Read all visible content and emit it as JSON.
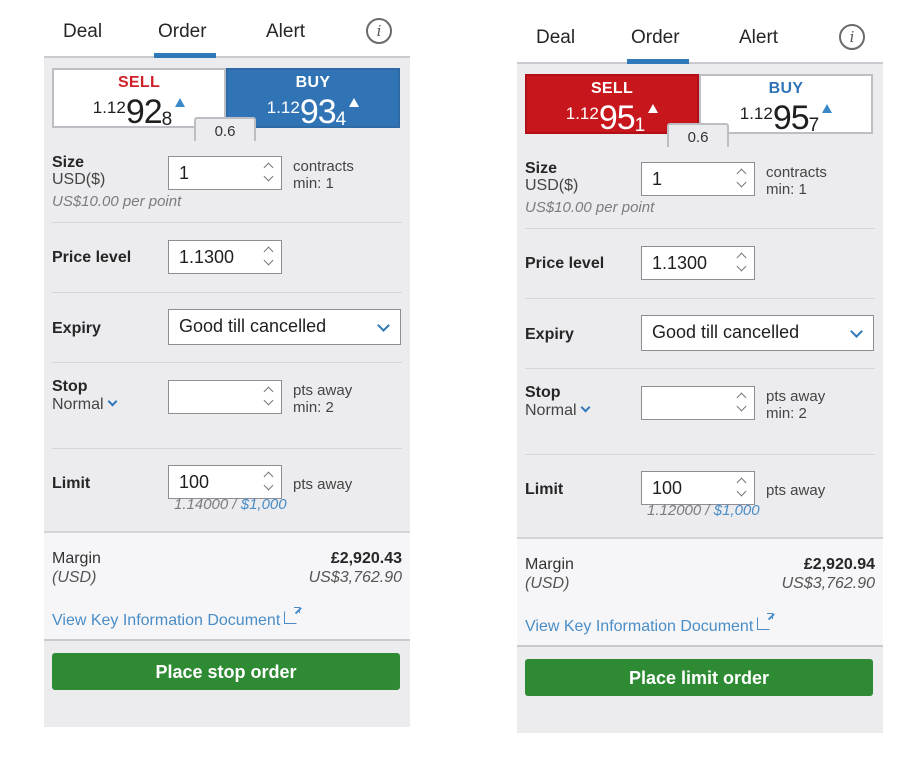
{
  "tickets": [
    {
      "tabs": [
        {
          "label": "Deal"
        },
        {
          "label": "Order"
        },
        {
          "label": "Alert"
        }
      ],
      "active_tab": "Order",
      "info_icon": "info-icon",
      "sell": {
        "label": "SELL",
        "prefix": "1.12",
        "big": "92",
        "pip": "8",
        "direction": "up",
        "selected": false
      },
      "buy": {
        "label": "BUY",
        "prefix": "1.12",
        "big": "93",
        "pip": "4",
        "direction": "up",
        "selected": true
      },
      "spread": "0.6",
      "size": {
        "label": "Size",
        "currency": "USD($)",
        "value": "1",
        "unit": "contracts",
        "min": "min: 1",
        "per_point": "US$10.00 per point"
      },
      "price_level": {
        "label": "Price level",
        "value": "1.1300"
      },
      "expiry": {
        "label": "Expiry",
        "value": "Good till cancelled"
      },
      "stop": {
        "label": "Stop",
        "type": "Normal",
        "value": "",
        "unit": "pts away",
        "min": "min: 2"
      },
      "limit": {
        "label": "Limit",
        "value": "100",
        "unit": "pts away",
        "level": "1.14000 /",
        "amount": "$1,000"
      },
      "margin": {
        "label": "Margin",
        "currency": "(USD)",
        "gbp": "£2,920.43",
        "usd": "US$3,762.90"
      },
      "kid_link": "View Key Information Document",
      "place_button": "Place stop order"
    },
    {
      "tabs": [
        {
          "label": "Deal"
        },
        {
          "label": "Order"
        },
        {
          "label": "Alert"
        }
      ],
      "active_tab": "Order",
      "info_icon": "info-icon",
      "sell": {
        "label": "SELL",
        "prefix": "1.12",
        "big": "95",
        "pip": "1",
        "direction": "up",
        "selected": true
      },
      "buy": {
        "label": "BUY",
        "prefix": "1.12",
        "big": "95",
        "pip": "7",
        "direction": "up",
        "selected": false
      },
      "spread": "0.6",
      "size": {
        "label": "Size",
        "currency": "USD($)",
        "value": "1",
        "unit": "contracts",
        "min": "min: 1",
        "per_point": "US$10.00 per point"
      },
      "price_level": {
        "label": "Price level",
        "value": "1.1300"
      },
      "expiry": {
        "label": "Expiry",
        "value": "Good till cancelled"
      },
      "stop": {
        "label": "Stop",
        "type": "Normal",
        "value": "",
        "unit": "pts away",
        "min": "min: 2"
      },
      "limit": {
        "label": "Limit",
        "value": "100",
        "unit": "pts away",
        "level": "1.12000 /",
        "amount": "$1,000"
      },
      "margin": {
        "label": "Margin",
        "currency": "(USD)",
        "gbp": "£2,920.94",
        "usd": "US$3,762.90"
      },
      "kid_link": "View Key Information Document",
      "place_button": "Place limit order"
    }
  ],
  "colors": {
    "buy_blue": "#3174b6",
    "sell_red": "#c8161d",
    "place_green": "#2e8b33",
    "link_blue": "#4a8dc6",
    "tab_underline": "#2f78b9"
  }
}
